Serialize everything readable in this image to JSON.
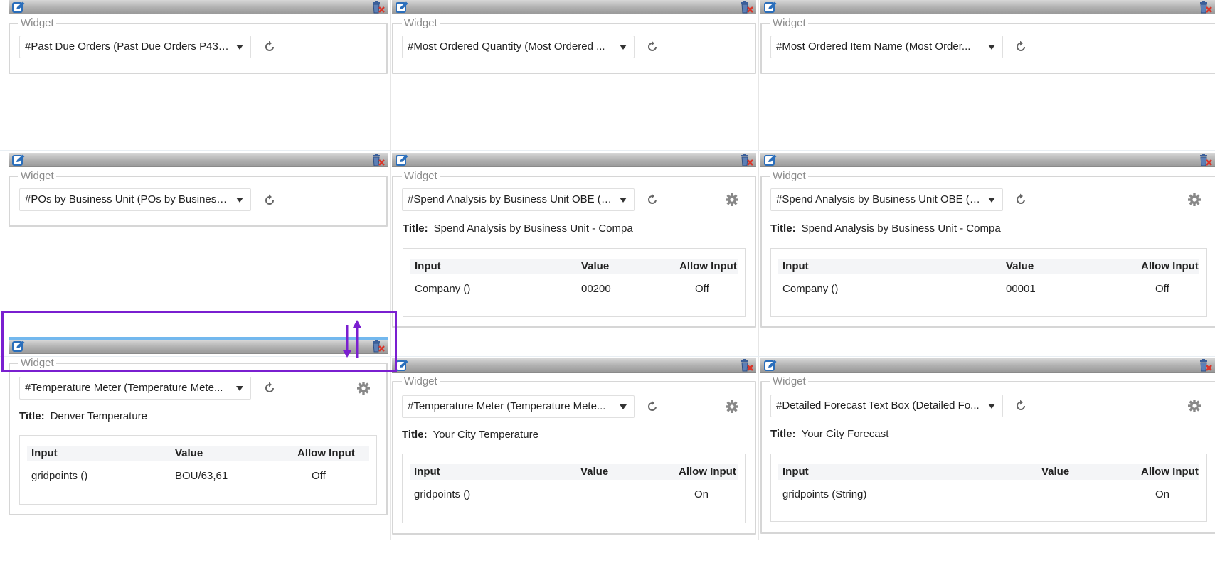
{
  "widget_legend": "Widget",
  "table_headers": {
    "input": "Input",
    "value": "Value",
    "allow_input": "Allow Input"
  },
  "title_label": "Title:",
  "icons": {
    "edit": "edit-icon",
    "delete": "delete-icon",
    "refresh": "refresh-icon",
    "settings": "gear-icon",
    "dropdown": "chevron-down-icon",
    "resize": "resize-arrows-icon"
  },
  "colors": {
    "active_header_accent": "#73b8ee",
    "drag_outline": "#7a1fd0",
    "edit_icon": "#2a6ebb",
    "delete_x": "#d9362b"
  },
  "widgets": [
    {
      "select": "#Past Due Orders (Past Due Orders P43 ..."
    },
    {
      "select": "#Most Ordered Quantity (Most Ordered ..."
    },
    {
      "select": "#Most Ordered Item Name (Most Order..."
    },
    {
      "select": "#POs by Business Unit (POs by Business ..."
    },
    {
      "select": "#Spend Analysis by Business Unit OBE ( ...",
      "title": "Spend Analysis by Business Unit - Compa",
      "row": {
        "input": "Company ()",
        "value": "00200",
        "allow_input": "Off"
      }
    },
    {
      "select": "#Spend Analysis by Business Unit OBE ( ...",
      "title": "Spend Analysis by Business Unit - Compa",
      "row": {
        "input": "Company ()",
        "value": "00001",
        "allow_input": "Off"
      }
    },
    {
      "select": "#Temperature Meter (Temperature Mete...",
      "title": "Denver Temperature",
      "row": {
        "input": "gridpoints ()",
        "value": "BOU/63,61",
        "allow_input": "Off"
      }
    },
    {
      "select": "#Temperature Meter (Temperature Mete...",
      "title": "Your City Temperature",
      "row": {
        "input": "gridpoints ()",
        "value": "",
        "allow_input": "On"
      }
    },
    {
      "select": "#Detailed Forecast Text Box (Detailed Fo...",
      "title": "Your City Forecast",
      "row": {
        "input": "gridpoints (String)",
        "value": "",
        "allow_input": "On"
      }
    }
  ]
}
